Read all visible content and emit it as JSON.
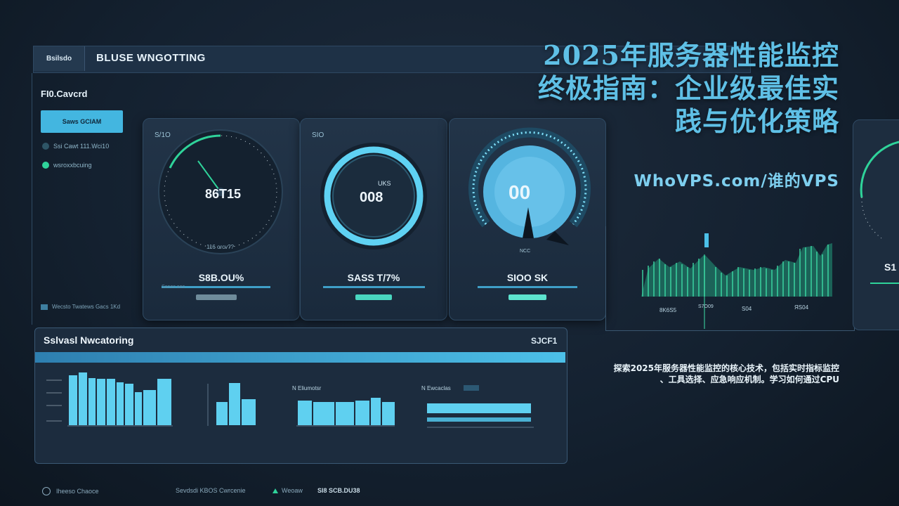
{
  "topbar": {
    "logo": "Bsilsdo",
    "title": "BLUSE WNGOTTING"
  },
  "sidebar": {
    "title": "FI0.Cavcrd",
    "button": "Saws GCIAM",
    "items": [
      "Ssi Cawt 111.Wci10",
      "wsroxxbcuing"
    ],
    "footer": "Wecsto Twatews Gacs 1Kd"
  },
  "gauges": [
    {
      "tag": "S/1O",
      "value": "86T15",
      "sub": "116 orcv??",
      "big": "S8B.OU%",
      "bar_caption": "Sanes aes"
    },
    {
      "tag": "SIO",
      "value": "008",
      "small": "UKS",
      "big": "SASS T/7%",
      "bar_caption": ""
    },
    {
      "tag": "",
      "value": "00",
      "small": "NCC",
      "big": "SIOO SK",
      "bar_caption": ""
    }
  ],
  "right_chart": {
    "labels": [
      "8K6S5",
      "S7O09",
      "S04",
      "ЯS04"
    ]
  },
  "right_edge": {
    "value": "S1"
  },
  "bottom": {
    "title": "Sslvasl Nwcatoring",
    "right_value": "SJCF1",
    "chart_labels": [
      "N Eliumotsr",
      "N Ewcaclas"
    ]
  },
  "footer": {
    "left": "Iheeso Chaoce",
    "middle": "Sevdsdi KBOS Cwrcenie",
    "status": "Weoaw",
    "value": "SI8 SCB.DU38"
  },
  "headline": {
    "line1": "2025年服务器性能监控",
    "line2": "终极指南：企业级最佳实",
    "line3": "践与优化策略"
  },
  "site": "WhoVPS.com/谁的VPS",
  "description": {
    "line1": "探索2025年服务器性能监控的核心技术，包括实时指标监控",
    "line2": "、工具选择、应急响应机制。学习如何通过CPU"
  },
  "colors": {
    "accent": "#4cc0e8",
    "green": "#2fd39a",
    "headline": "#5fc0e6",
    "bg": "#142130"
  }
}
